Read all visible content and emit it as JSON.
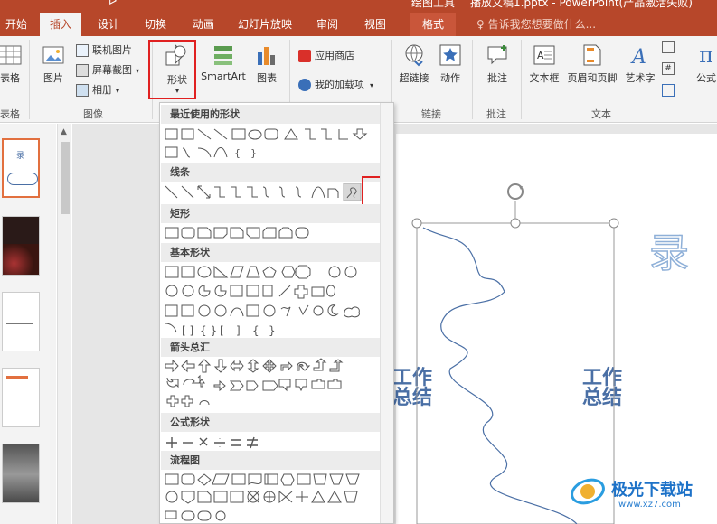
{
  "window": {
    "title_left": "绘图工具",
    "title_right": "播放文稿1.pptx - PowerPoint(产品激活失败)"
  },
  "tabs": [
    "开始",
    "插入",
    "设计",
    "切换",
    "动画",
    "幻灯片放映",
    "审阅",
    "视图",
    "格式"
  ],
  "active_tab": "插入",
  "tell_me": "告诉我您想要做什么...",
  "ribbon": {
    "groups": {
      "tables": "表格",
      "images": "图像",
      "links": "链接",
      "comments": "批注",
      "text": "文本"
    },
    "buttons": {
      "table": "表格",
      "picture": "图片",
      "online_pictures": "联机图片",
      "screenshot": "屏幕截图",
      "album": "相册",
      "shapes": "形状",
      "smartart": "SmartArt",
      "chart": "图表",
      "store": "应用商店",
      "my_addins": "我的加载项",
      "hyperlink": "超链接",
      "action": "动作",
      "comment": "批注",
      "textbox": "文本框",
      "header_footer": "页眉和页脚",
      "wordart": "艺术字",
      "equation": "公式"
    }
  },
  "shapes_menu": {
    "sections": [
      "最近使用的形状",
      "线条",
      "矩形",
      "基本形状",
      "箭头总汇",
      "公式形状",
      "流程图"
    ],
    "selected_shape": "freeform-scribble"
  },
  "slide": {
    "title_fragment": "录",
    "left_text": "工作\n总结",
    "right_text": "工作\n总结"
  },
  "thumbnails": {
    "slide1_title": "录"
  },
  "watermark": {
    "name": "极光下载站",
    "url": "www.xz7.com"
  },
  "colors": {
    "accent": "#b7472a",
    "highlight": "#e02020",
    "slide_text": "#4a6fa5"
  }
}
